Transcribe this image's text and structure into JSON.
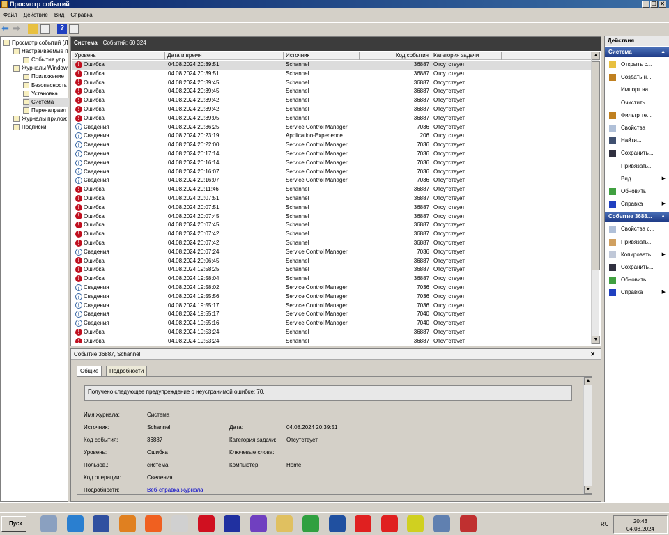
{
  "window": {
    "title": "Просмотр событий",
    "buttons": [
      "_",
      "❐",
      "✕"
    ]
  },
  "menu": [
    "Файл",
    "Действие",
    "Вид",
    "Справка"
  ],
  "tree": [
    {
      "label": "Просмотр событий (Л",
      "indent": 0
    },
    {
      "label": "Настраиваемые п",
      "indent": 1
    },
    {
      "label": "События упр",
      "indent": 2
    },
    {
      "label": "Журналы Window",
      "indent": 1
    },
    {
      "label": "Приложение",
      "indent": 2
    },
    {
      "label": "Безопасность",
      "indent": 2
    },
    {
      "label": "Установка",
      "indent": 2
    },
    {
      "label": "Система",
      "indent": 2,
      "selected": true
    },
    {
      "label": "Перенаправл",
      "indent": 2
    },
    {
      "label": "Журналы прилож",
      "indent": 1
    },
    {
      "label": "Подписки",
      "indent": 1
    }
  ],
  "log": {
    "name": "Система",
    "count_label": "Событий: 60 324"
  },
  "columns": [
    "Уровень",
    "Дата и время",
    "Источник",
    "Код события",
    "Категория задачи"
  ],
  "rows": [
    [
      "Ошибка",
      "04.08.2024 20:39:51",
      "Schannel",
      "36887",
      "Отсутствует"
    ],
    [
      "Ошибка",
      "04.08.2024 20:39:51",
      "Schannel",
      "36887",
      "Отсутствует"
    ],
    [
      "Ошибка",
      "04.08.2024 20:39:45",
      "Schannel",
      "36887",
      "Отсутствует"
    ],
    [
      "Ошибка",
      "04.08.2024 20:39:45",
      "Schannel",
      "36887",
      "Отсутствует"
    ],
    [
      "Ошибка",
      "04.08.2024 20:39:42",
      "Schannel",
      "36887",
      "Отсутствует"
    ],
    [
      "Ошибка",
      "04.08.2024 20:39:42",
      "Schannel",
      "36887",
      "Отсутствует"
    ],
    [
      "Ошибка",
      "04.08.2024 20:39:05",
      "Schannel",
      "36887",
      "Отсутствует"
    ],
    [
      "Сведения",
      "04.08.2024 20:36:25",
      "Service Control Manager",
      "7036",
      "Отсутствует"
    ],
    [
      "Сведения",
      "04.08.2024 20:23:19",
      "Application-Experience",
      "206",
      "Отсутствует"
    ],
    [
      "Сведения",
      "04.08.2024 20:22:00",
      "Service Control Manager",
      "7036",
      "Отсутствует"
    ],
    [
      "Сведения",
      "04.08.2024 20:17:14",
      "Service Control Manager",
      "7036",
      "Отсутствует"
    ],
    [
      "Сведения",
      "04.08.2024 20:16:14",
      "Service Control Manager",
      "7036",
      "Отсутствует"
    ],
    [
      "Сведения",
      "04.08.2024 20:16:07",
      "Service Control Manager",
      "7036",
      "Отсутствует"
    ],
    [
      "Сведения",
      "04.08.2024 20:16:07",
      "Service Control Manager",
      "7036",
      "Отсутствует"
    ],
    [
      "Ошибка",
      "04.08.2024 20:11:46",
      "Schannel",
      "36887",
      "Отсутствует"
    ],
    [
      "Ошибка",
      "04.08.2024 20:07:51",
      "Schannel",
      "36887",
      "Отсутствует"
    ],
    [
      "Ошибка",
      "04.08.2024 20:07:51",
      "Schannel",
      "36887",
      "Отсутствует"
    ],
    [
      "Ошибка",
      "04.08.2024 20:07:45",
      "Schannel",
      "36887",
      "Отсутствует"
    ],
    [
      "Ошибка",
      "04.08.2024 20:07:45",
      "Schannel",
      "36887",
      "Отсутствует"
    ],
    [
      "Ошибка",
      "04.08.2024 20:07:42",
      "Schannel",
      "36887",
      "Отсутствует"
    ],
    [
      "Ошибка",
      "04.08.2024 20:07:42",
      "Schannel",
      "36887",
      "Отсутствует"
    ],
    [
      "Сведения",
      "04.08.2024 20:07:24",
      "Service Control Manager",
      "7036",
      "Отсутствует"
    ],
    [
      "Ошибка",
      "04.08.2024 20:06:45",
      "Schannel",
      "36887",
      "Отсутствует"
    ],
    [
      "Ошибка",
      "04.08.2024 19:58:25",
      "Schannel",
      "36887",
      "Отсутствует"
    ],
    [
      "Ошибка",
      "04.08.2024 19:58:04",
      "Schannel",
      "36887",
      "Отсутствует"
    ],
    [
      "Сведения",
      "04.08.2024 19:58:02",
      "Service Control Manager",
      "7036",
      "Отсутствует"
    ],
    [
      "Сведения",
      "04.08.2024 19:55:56",
      "Service Control Manager",
      "7036",
      "Отсутствует"
    ],
    [
      "Сведения",
      "04.08.2024 19:55:17",
      "Service Control Manager",
      "7036",
      "Отсутствует"
    ],
    [
      "Сведения",
      "04.08.2024 19:55:17",
      "Service Control Manager",
      "7040",
      "Отсутствует"
    ],
    [
      "Сведения",
      "04.08.2024 19:55:16",
      "Service Control Manager",
      "7040",
      "Отсутствует"
    ],
    [
      "Ошибка",
      "04.08.2024 19:53:24",
      "Schannel",
      "36887",
      "Отсутствует"
    ],
    [
      "Ошибка",
      "04.08.2024 19:53:24",
      "Schannel",
      "36887",
      "Отсутствует"
    ]
  ],
  "detail": {
    "title": "Событие 36887, Schannel",
    "tabs": [
      "Общие",
      "Подробности"
    ],
    "message": "Получено следующее предупреждение о неустранимой ошибке: 70.",
    "labels": {
      "log": "Имя журнала:",
      "source": "Источник:",
      "event_id": "Код события:",
      "level": "Уровень:",
      "user": "Пользов.:",
      "opcode": "Код операции:",
      "more": "Подробности:",
      "date": "Дата:",
      "category": "Категория задачи:",
      "keywords": "Ключевые слова:",
      "computer": "Компьютер:"
    },
    "values": {
      "log": "Система",
      "source": "Schannel",
      "event_id": "36887",
      "level": "Ошибка",
      "user": "система",
      "opcode": "Сведения",
      "more": "Веб-справка журнала",
      "date": "04.08.2024 20:39:51",
      "category": "Отсутствует",
      "keywords": "",
      "computer": "Home"
    }
  },
  "actions": {
    "title": "Действия",
    "sections": [
      {
        "header": "Система",
        "items": [
          {
            "label": "Открыть с...",
            "icon": "folder-open-icon"
          },
          {
            "label": "Создать н...",
            "icon": "filter-icon"
          },
          {
            "label": "Импорт на...",
            "icon": ""
          },
          {
            "label": "Очистить ...",
            "icon": ""
          },
          {
            "label": "Фильтр те...",
            "icon": "filter-icon"
          },
          {
            "label": "Свойства",
            "icon": "properties-icon"
          },
          {
            "label": "Найти...",
            "icon": "binoculars-icon"
          },
          {
            "label": "Сохранить...",
            "icon": "save-icon"
          },
          {
            "label": "Привязать...",
            "icon": ""
          },
          {
            "label": "Вид",
            "icon": "",
            "submenu": true
          },
          {
            "label": "Обновить",
            "icon": "refresh-icon"
          },
          {
            "label": "Справка",
            "icon": "help-icon",
            "submenu": true
          }
        ]
      },
      {
        "header": "Событие 3688...",
        "items": [
          {
            "label": "Свойства с...",
            "icon": "properties-icon"
          },
          {
            "label": "Привязать...",
            "icon": "task-icon"
          },
          {
            "label": "Копировать",
            "icon": "copy-icon",
            "submenu": true
          },
          {
            "label": "Сохранить...",
            "icon": "save-icon"
          },
          {
            "label": "Обновить",
            "icon": "refresh-icon"
          },
          {
            "label": "Справка",
            "icon": "help-icon",
            "submenu": true
          }
        ]
      }
    ]
  },
  "taskbar": {
    "start": "Пуск",
    "lang": "RU",
    "time": "20:43",
    "date": "04.08.2024",
    "apps": [
      "calculator",
      "internet-explorer",
      "paint",
      "media-player",
      "firefox",
      "java",
      "opera",
      "floppy-save",
      "viber",
      "file-manager",
      "chrome",
      "word",
      "yandex",
      "yandex-browser",
      "check-app",
      "control-panel",
      "toolbox"
    ]
  },
  "colors": {
    "error": "#c01020",
    "header": "#3c3c3c",
    "accent": "#1f3c88"
  }
}
